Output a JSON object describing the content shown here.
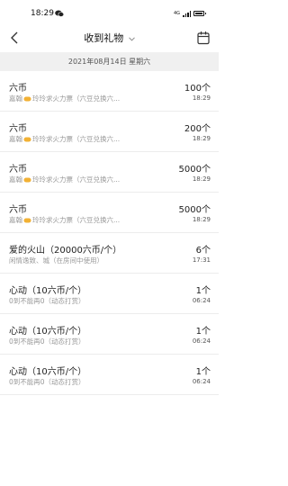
{
  "status_bar": {
    "time": "18:29",
    "wifi_label": "4G"
  },
  "nav": {
    "title": "收到礼物"
  },
  "date_header": "2021年08月14日 星期六",
  "gifts": [
    {
      "name": "六币",
      "sub_prefix": "嘉翰",
      "sub_suffix": "玲玲求火力票（六豆兑换六...",
      "count": "100个",
      "time": "18:29",
      "emoji": true
    },
    {
      "name": "六币",
      "sub_prefix": "嘉翰",
      "sub_suffix": "玲玲求火力票（六豆兑换六...",
      "count": "200个",
      "time": "18:29",
      "emoji": true
    },
    {
      "name": "六币",
      "sub_prefix": "嘉翰",
      "sub_suffix": "玲玲求火力票（六豆兑换六...",
      "count": "5000个",
      "time": "18:29",
      "emoji": true
    },
    {
      "name": "六币",
      "sub_prefix": "嘉翰",
      "sub_suffix": "玲玲求火力票（六豆兑换六...",
      "count": "5000个",
      "time": "18:29",
      "emoji": true
    },
    {
      "name": "爱的火山（20000六币/个）",
      "sub_prefix": "闲情逸致、城（在房间中使用）",
      "sub_suffix": "",
      "count": "6个",
      "time": "17:31",
      "emoji": false
    },
    {
      "name": "心动（10六币/个）",
      "sub_prefix": "0到不能再0（动态打赏）",
      "sub_suffix": "",
      "count": "1个",
      "time": "06:24",
      "emoji": false
    },
    {
      "name": "心动（10六币/个）",
      "sub_prefix": "0到不能再0（动态打赏）",
      "sub_suffix": "",
      "count": "1个",
      "time": "06:24",
      "emoji": false
    },
    {
      "name": "心动（10六币/个）",
      "sub_prefix": "0到不能再0（动态打赏）",
      "sub_suffix": "",
      "count": "1个",
      "time": "06:24",
      "emoji": false
    }
  ],
  "colors": {
    "date_bar_bg": "#f0f0f0",
    "emoji": "#f2b134"
  },
  "icons": [
    "wechat-icon",
    "signal-icon",
    "battery-icon",
    "back-arrow-icon",
    "chevron-down-icon",
    "calendar-icon",
    "pill-emoji-icon"
  ]
}
